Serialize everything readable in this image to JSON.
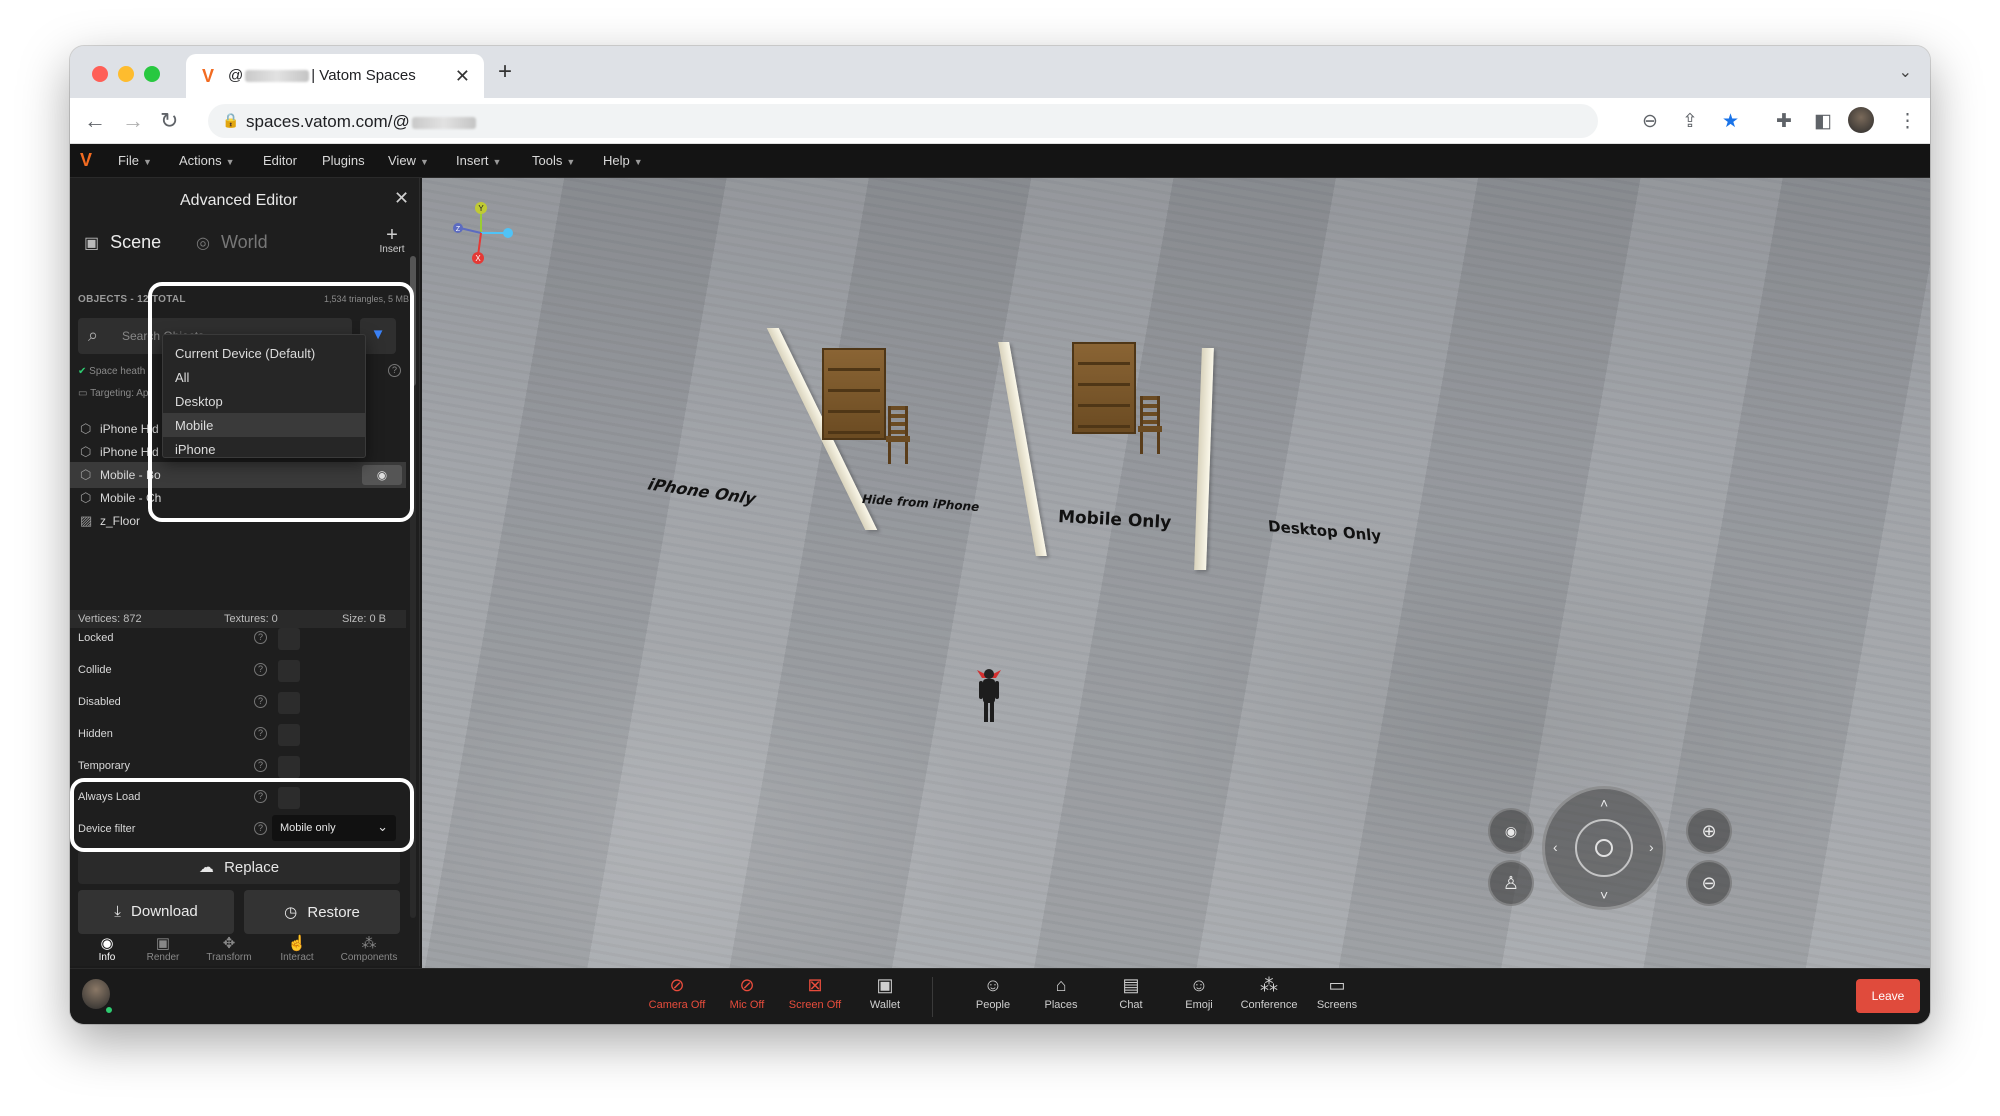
{
  "browser": {
    "tab_title": "@ | Vatom Spaces",
    "tab_title_prefix": "@",
    "tab_title_suffix": "| Vatom Spaces",
    "url_prefix": "spaces.vatom.com/@",
    "favicon": "V"
  },
  "menubar": {
    "items": [
      "File",
      "Actions",
      "Editor",
      "Plugins",
      "View",
      "Insert",
      "Tools",
      "Help"
    ]
  },
  "panel": {
    "title": "Advanced Editor",
    "tabs": {
      "scene": "Scene",
      "world": "World"
    },
    "insert_label": "Insert",
    "objects_header": "OBJECTS - 12 TOTAL",
    "objects_stats": "1,534 triangles, 5 MB",
    "search_placeholder": "Search Objects...",
    "health_text": "Space heath",
    "targeting_text": "Targeting: Ap",
    "objects": [
      {
        "name": "iPhone Hid"
      },
      {
        "name": "iPhone Hid"
      },
      {
        "name": "Mobile - Bo"
      },
      {
        "name": "Mobile - Ch"
      },
      {
        "name": "z_Floor"
      }
    ],
    "stats": {
      "vertices": "Vertices: 872",
      "textures": "Textures: 0",
      "size": "Size: 0 B"
    },
    "properties": [
      "Locked",
      "Collide",
      "Disabled",
      "Hidden",
      "Temporary",
      "Always Load"
    ],
    "device_filter_label": "Device filter",
    "device_filter_value": "Mobile only",
    "replace_label": "Replace",
    "download_label": "Download",
    "restore_label": "Restore",
    "bottom_tabs": [
      "Info",
      "Render",
      "Transform",
      "Interact",
      "Components"
    ]
  },
  "dropdown": {
    "options": [
      "Current Device (Default)",
      "All",
      "Desktop",
      "Mobile",
      "iPhone"
    ],
    "hovered": "Mobile"
  },
  "viewport": {
    "floor_labels": [
      "iPhone Only",
      "Hide from iPhone",
      "Mobile Only",
      "Desktop Only"
    ],
    "gizmo_axes": [
      "Y",
      "Z",
      "X"
    ]
  },
  "bottombar": {
    "buttons": [
      {
        "label": "Camera Off",
        "icon": "camera-off-icon",
        "state": "off"
      },
      {
        "label": "Mic Off",
        "icon": "mic-off-icon",
        "state": "off"
      },
      {
        "label": "Screen Off",
        "icon": "screen-off-icon",
        "state": "off"
      },
      {
        "label": "Wallet",
        "icon": "wallet-icon",
        "state": "normal"
      },
      {
        "label": "People",
        "icon": "people-icon",
        "state": "normal"
      },
      {
        "label": "Places",
        "icon": "places-icon",
        "state": "normal"
      },
      {
        "label": "Chat",
        "icon": "chat-icon",
        "state": "normal"
      },
      {
        "label": "Emoji",
        "icon": "emoji-icon",
        "state": "normal"
      },
      {
        "label": "Conference",
        "icon": "conference-icon",
        "state": "normal"
      },
      {
        "label": "Screens",
        "icon": "screens-icon",
        "state": "normal"
      }
    ],
    "leave_label": "Leave"
  },
  "colors": {
    "accent": "#f26b21",
    "filter_blue": "#3b82f6",
    "off_red": "#e74c3c",
    "leave_red": "#e04b3c"
  }
}
